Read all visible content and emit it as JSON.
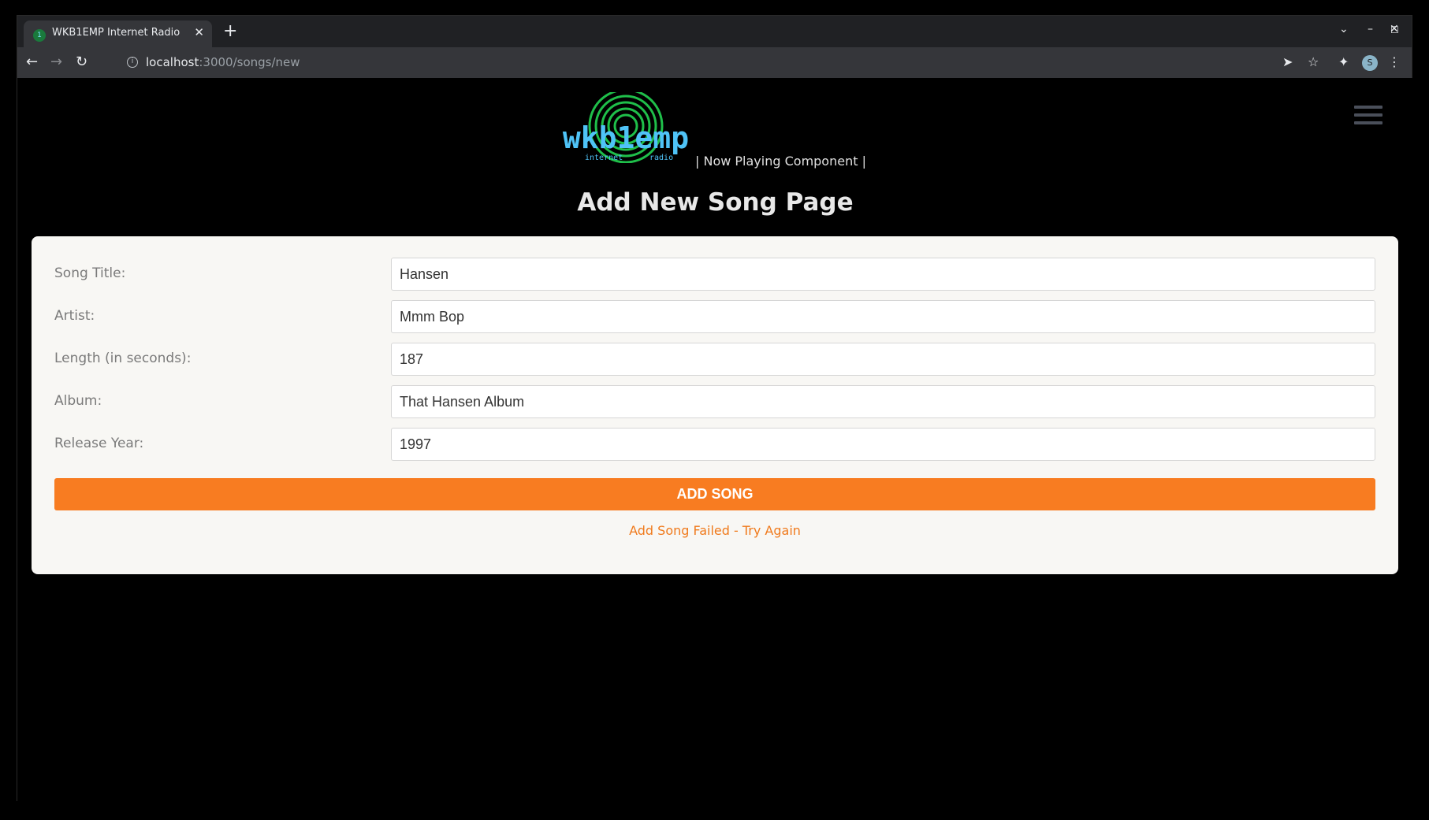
{
  "browser": {
    "tab_title": "WKB1EMP Internet Radio",
    "tab_favicon": "1",
    "url_host": "localhost",
    "url_path": ":3000/songs/new",
    "profile_initial": "S"
  },
  "header": {
    "logo_text": "wkb1emp",
    "logo_sub_left": "internet",
    "logo_sub_right": "radio",
    "nav_link": "|  Now Playing Component  |"
  },
  "page": {
    "title": "Add New Song Page"
  },
  "form": {
    "fields": [
      {
        "label": "Song Title:",
        "value": "Hansen"
      },
      {
        "label": "Artist:",
        "value": "Mmm Bop"
      },
      {
        "label": "Length (in seconds):",
        "value": "187"
      },
      {
        "label": "Album:",
        "value": "That Hansen Album"
      },
      {
        "label": "Release Year:",
        "value": "1997"
      }
    ],
    "submit_label": "ADD SONG",
    "status_message": "Add Song Failed - Try Again"
  },
  "colors": {
    "accent": "#f87c21",
    "logo_green": "#1fbf4a",
    "logo_blue": "#4fc3f7"
  }
}
